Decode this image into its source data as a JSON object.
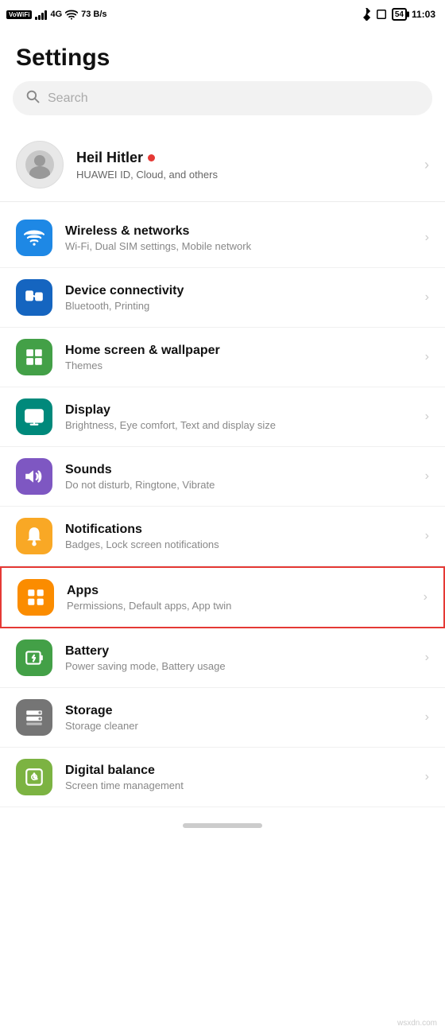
{
  "statusBar": {
    "left": {
      "vowifi": "VoWiFi",
      "signal": "4G",
      "speed": "73 B/s"
    },
    "right": {
      "battery": "54",
      "time": "11:03"
    }
  },
  "pageTitle": "Settings",
  "search": {
    "placeholder": "Search"
  },
  "profile": {
    "name": "Heil Hitler",
    "subtitle": "HUAWEI ID, Cloud, and others"
  },
  "settingsItems": [
    {
      "id": "wireless",
      "iconColor": "bg-blue",
      "title": "Wireless & networks",
      "subtitle": "Wi-Fi, Dual SIM settings, Mobile network",
      "highlighted": false
    },
    {
      "id": "device-connectivity",
      "iconColor": "bg-blue2",
      "title": "Device connectivity",
      "subtitle": "Bluetooth, Printing",
      "highlighted": false
    },
    {
      "id": "home-screen",
      "iconColor": "bg-green",
      "title": "Home screen & wallpaper",
      "subtitle": "Themes",
      "highlighted": false
    },
    {
      "id": "display",
      "iconColor": "bg-green2",
      "title": "Display",
      "subtitle": "Brightness, Eye comfort, Text and display size",
      "highlighted": false
    },
    {
      "id": "sounds",
      "iconColor": "bg-purple",
      "title": "Sounds",
      "subtitle": "Do not disturb, Ringtone, Vibrate",
      "highlighted": false
    },
    {
      "id": "notifications",
      "iconColor": "bg-yellow",
      "title": "Notifications",
      "subtitle": "Badges, Lock screen notifications",
      "highlighted": false
    },
    {
      "id": "apps",
      "iconColor": "bg-orange",
      "title": "Apps",
      "subtitle": "Permissions, Default apps, App twin",
      "highlighted": true
    },
    {
      "id": "battery",
      "iconColor": "bg-green",
      "title": "Battery",
      "subtitle": "Power saving mode, Battery usage",
      "highlighted": false
    },
    {
      "id": "storage",
      "iconColor": "bg-gray",
      "title": "Storage",
      "subtitle": "Storage cleaner",
      "highlighted": false
    },
    {
      "id": "digital-balance",
      "iconColor": "bg-lime",
      "title": "Digital balance",
      "subtitle": "Screen time management",
      "highlighted": false
    }
  ],
  "watermark": "wsxdn.com"
}
